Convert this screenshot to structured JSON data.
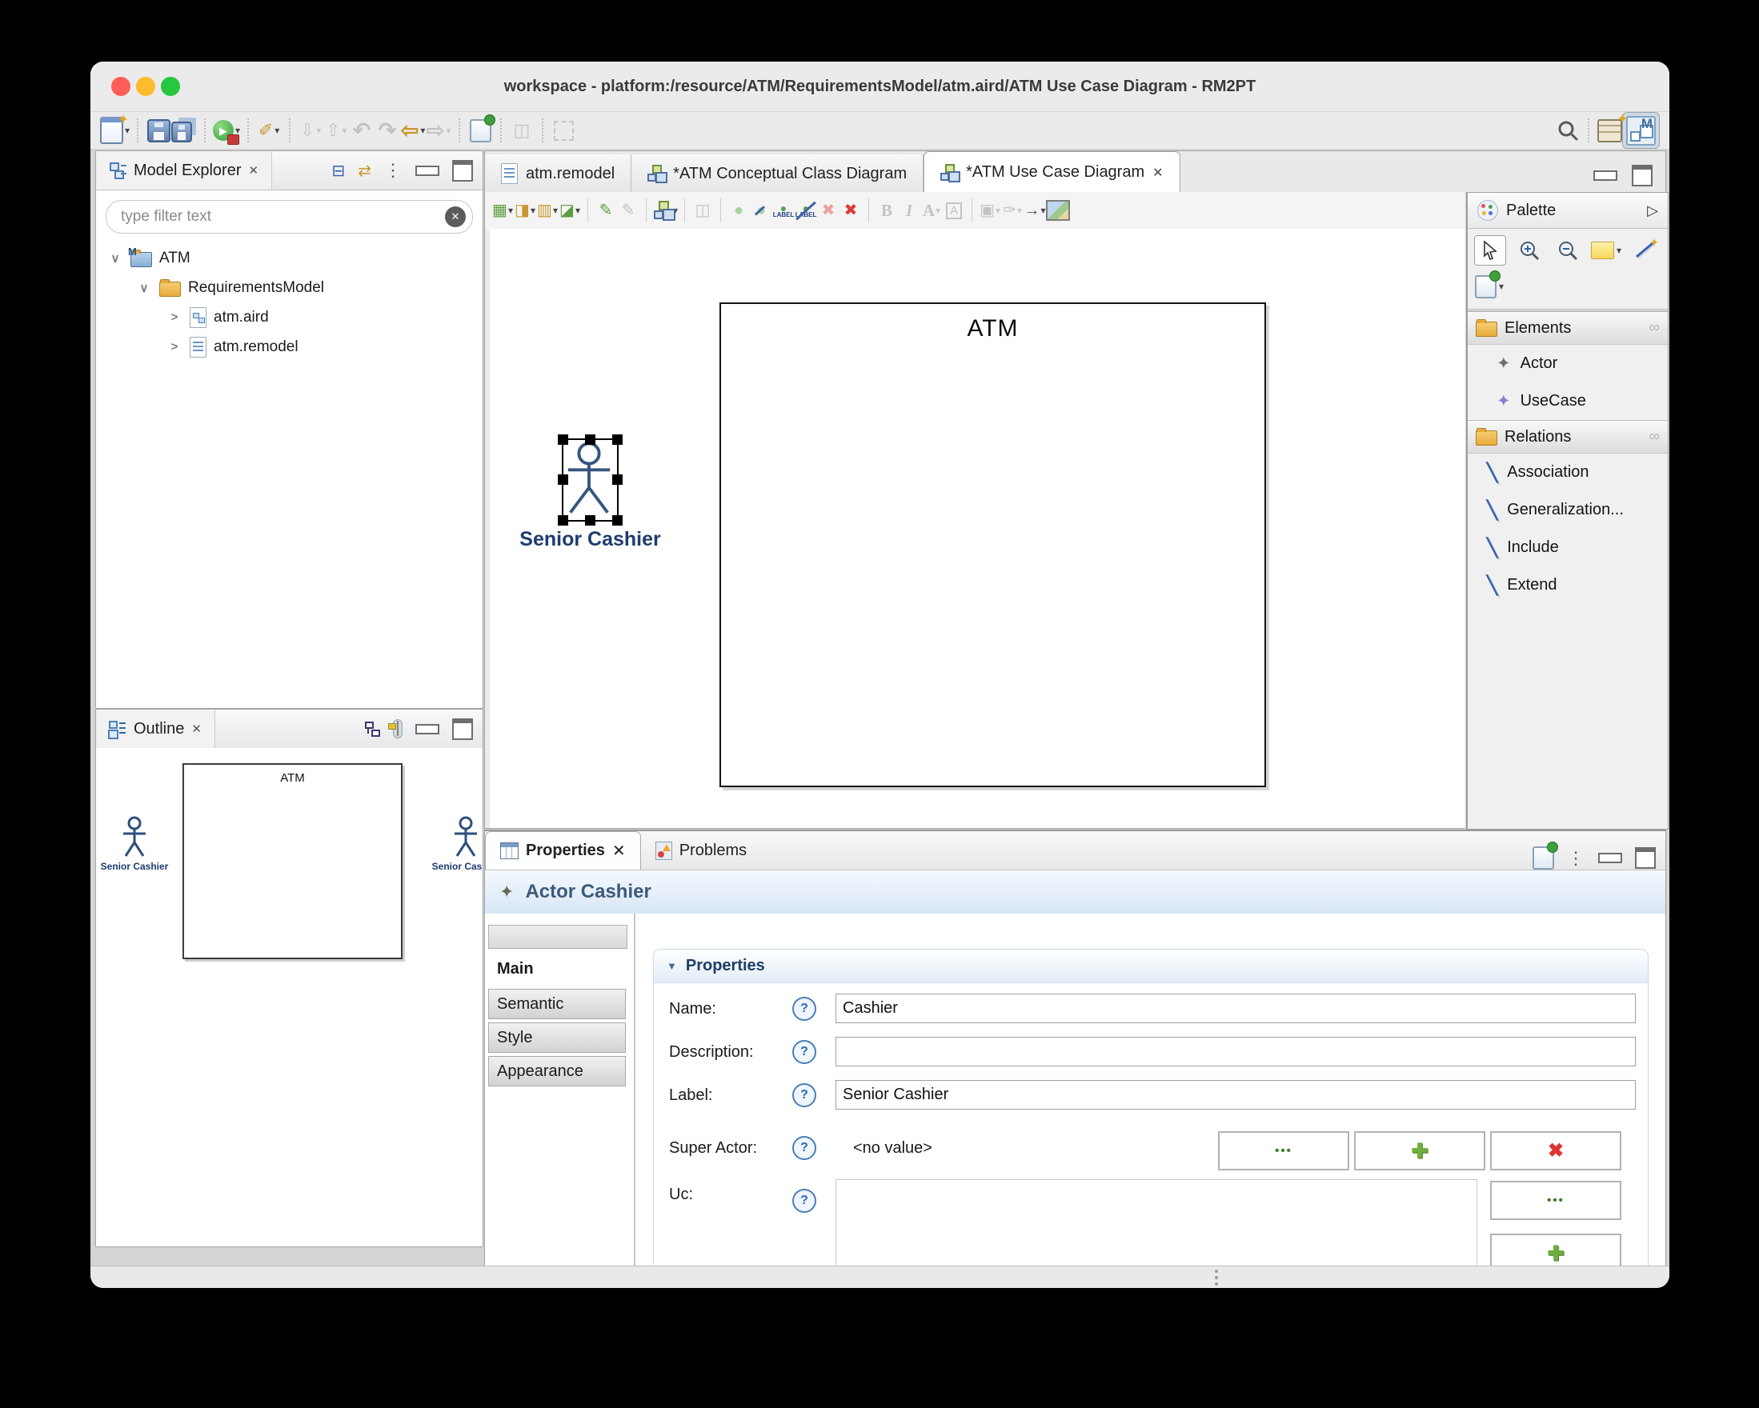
{
  "titlebar": {
    "title": "workspace - platform:/resource/ATM/RequirementsModel/atm.aird/ATM Use Case Diagram - RM2PT"
  },
  "glyphs": {
    "dropdown": "▾",
    "tree_open": "∨",
    "tree_closed": ">",
    "run_play": "▶",
    "marker": "✐",
    "import_doc": "⇩",
    "export_doc": "⇧",
    "undo": "↶",
    "redo": "↷",
    "back": "⇦",
    "forward": "⇨",
    "copy_layout": "◫",
    "arrange": "▦",
    "align": "◨",
    "distribute": "▥",
    "straighten": "◪",
    "pencil": "✎",
    "ellipse": "●",
    "label_text": "LABEL",
    "delete_x": "✖",
    "bold": "B",
    "italic": "I",
    "font_a": "A",
    "fill": "▣",
    "brush": "✑",
    "line_arrow": "→",
    "star4": "✦",
    "rel_line": "╲",
    "menu_dots": "⋮",
    "collapse_all": "⊟",
    "link_editor": "⇄",
    "close_x": "✕",
    "help_q": "?",
    "palette_fly": "▷",
    "drawer_pin": "∞",
    "section_tri": "▼",
    "m_letter": "M",
    "ellipsis_btn": "•••",
    "plus_btn": "✚",
    "x_btn": "✖"
  },
  "model_explorer": {
    "title": "Model Explorer",
    "filter_placeholder": "type filter text",
    "tree": {
      "project": "ATM",
      "folder": "RequirementsModel",
      "file1": "atm.aird",
      "file2": "atm.remodel"
    }
  },
  "outline": {
    "title": "Outline",
    "system_label": "ATM",
    "actor_left": "Senior Cashier",
    "actor_right": "Senior Cashier"
  },
  "editor": {
    "tabs": {
      "t1": "atm.remodel",
      "t2": "*ATM Conceptual Class Diagram",
      "t3": "*ATM Use Case Diagram"
    },
    "canvas": {
      "system_label": "ATM",
      "actor_label": "Senior Cashier"
    }
  },
  "palette": {
    "title": "Palette",
    "elements_label": "Elements",
    "relations_label": "Relations",
    "items": {
      "actor": "Actor",
      "usecase": "UseCase",
      "association": "Association",
      "generalization": "Generalization...",
      "include": "Include",
      "extend": "Extend"
    }
  },
  "properties": {
    "tab_properties": "Properties",
    "tab_problems": "Problems",
    "header": "Actor Cashier",
    "side_tabs": {
      "main": "Main",
      "semantic": "Semantic",
      "style": "Style",
      "appearance": "Appearance"
    },
    "section_title": "Properties",
    "name_label": "Name:",
    "name_value": "Cashier",
    "description_label": "Description:",
    "description_value": "",
    "label_label": "Label:",
    "label_value": "Senior Cashier",
    "super_actor_label": "Super Actor:",
    "super_actor_value": "<no value>",
    "uc_label": "Uc:"
  },
  "colors": {
    "actor_stroke": "#36557e",
    "actor_label": "#1e3c6e",
    "header_text": "#3c5a7a",
    "selection_handle": "#000000"
  }
}
